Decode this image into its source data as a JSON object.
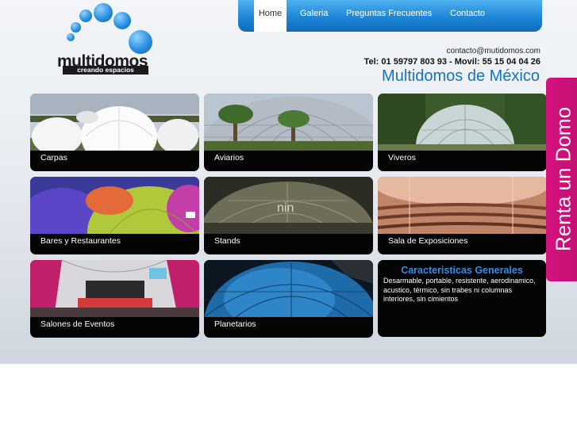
{
  "logo": {
    "wordmark": "multidomos",
    "tagline": "creando espacios"
  },
  "nav": {
    "items": [
      {
        "label": "Home",
        "active": true
      },
      {
        "label": "Galeria",
        "active": false
      },
      {
        "label": "Preguntas Frecuentes",
        "active": false
      },
      {
        "label": "Contacto",
        "active": false
      }
    ]
  },
  "contact": {
    "email": "contacto@mutidomos.com",
    "phones": "Tel: 01 59797 803 93 - Movil: 55 15 04 04 26",
    "title": "Multidomos de México"
  },
  "tiles": [
    {
      "label": "Carpas"
    },
    {
      "label": "Aviarios"
    },
    {
      "label": "Viveros"
    },
    {
      "label": "Bares y Restaurantes"
    },
    {
      "label": "Stands"
    },
    {
      "label": "Sala de Exposiciones"
    },
    {
      "label": "Salones de Eventos"
    },
    {
      "label": "Planetarios"
    }
  ],
  "features": {
    "title": "Caracteristicas Generales",
    "text": "Desarmable, portable, resistente, aerodinamico, acustico, térmico, sin trabes ni columnas interiores, sin cimientos"
  },
  "side_tab": {
    "label": "Renta un Domo"
  },
  "colors": {
    "nav_blue": "#1d86d6",
    "title_blue": "#1474c4",
    "accent_magenta": "#d4127e",
    "tile_bg": "#050505"
  }
}
